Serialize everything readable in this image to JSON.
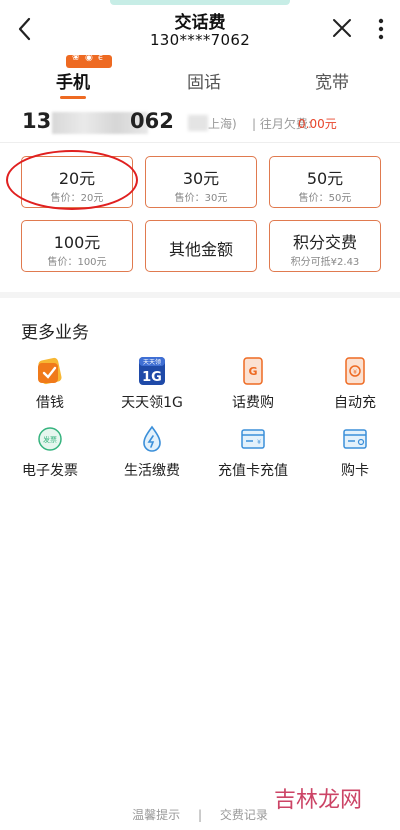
{
  "header": {
    "title": "交话费",
    "phone": "130****7062",
    "back_icon": "back-arrow-icon",
    "close_icon": "close-icon",
    "more_icon": "more-vertical-icon"
  },
  "tabs": [
    {
      "label": "手机",
      "active": true
    },
    {
      "label": "固话",
      "active": false
    },
    {
      "label": "宽带",
      "active": false
    }
  ],
  "account": {
    "number_prefix": "13",
    "number_suffix": "062",
    "region": "上海)",
    "arrears_label": "| 往月欠费:",
    "arrears_value": "0.00元"
  },
  "denominations": [
    {
      "amount": "20元",
      "price": "售价：20元",
      "selected": true
    },
    {
      "amount": "30元",
      "price": "售价：30元"
    },
    {
      "amount": "50元",
      "price": "售价：50元"
    },
    {
      "amount": "100元",
      "price": "售价：100元"
    },
    {
      "amount": "其他金额"
    },
    {
      "amount": "积分交费",
      "price": "积分可抵¥2.43"
    }
  ],
  "more_services": {
    "title": "更多业务",
    "items": [
      {
        "label": "借钱",
        "icon": "loan-icon"
      },
      {
        "label": "天天领1G",
        "icon": "daily-1g-icon"
      },
      {
        "label": "话费购",
        "icon": "phone-credit-shop-icon"
      },
      {
        "label": "自动充",
        "icon": "auto-recharge-icon"
      },
      {
        "label": "电子发票",
        "icon": "e-invoice-icon"
      },
      {
        "label": "生活缴费",
        "icon": "utility-payment-icon"
      },
      {
        "label": "充值卡充值",
        "icon": "recharge-card-icon"
      },
      {
        "label": "购卡",
        "icon": "buy-card-icon"
      }
    ]
  },
  "footer": {
    "tips": "温馨提示",
    "separator": "|",
    "records": "交费记录"
  },
  "watermark": "吉林龙网",
  "colors": {
    "accent": "#ee6a22",
    "card_border": "#e07a4f",
    "arrears_red": "#e8452b",
    "annotation_red": "#e02020"
  }
}
